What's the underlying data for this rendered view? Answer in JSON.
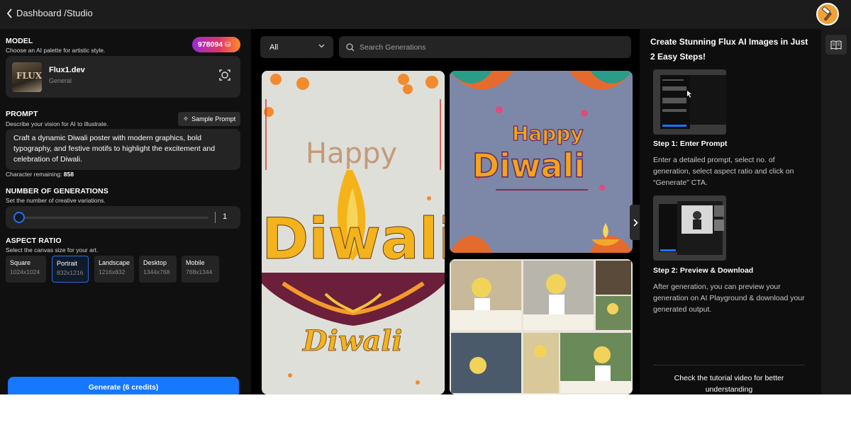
{
  "topbar": {
    "breadcrumb": "Dashboard /Studio"
  },
  "model": {
    "title": "MODEL",
    "subtitle": "Choose an AI palette for artistic style.",
    "credits": "978094",
    "name": "Flux1.dev",
    "type": "General",
    "thumb_text": "FLUX"
  },
  "prompt": {
    "title": "PROMPT",
    "subtitle": "Describe your vision for AI to illustrate.",
    "sample_label": "Sample Prompt",
    "text": "Craft a dynamic Diwali poster with modern graphics, bold typography, and festive motifs to highlight the excitement and celebration of Diwali.",
    "char_label": "Character remaining:",
    "char_count": "858"
  },
  "generations": {
    "title": "NUMBER OF GENERATIONS",
    "subtitle": "Set the number of creative variations.",
    "value": "1"
  },
  "aspect": {
    "title": "ASPECT RATIO",
    "subtitle": "Select the canvas size for your art.",
    "options": [
      {
        "name": "Square",
        "dims": "1024x1024"
      },
      {
        "name": "Portrait",
        "dims": "832x1216"
      },
      {
        "name": "Landscape",
        "dims": "1216x832"
      },
      {
        "name": "Desktop",
        "dims": "1344x768"
      },
      {
        "name": "Mobile",
        "dims": "768x1344"
      }
    ],
    "selected": "Portrait"
  },
  "generate_label": "Generate (6 credits)",
  "gallery": {
    "filter": "All",
    "search_placeholder": "Search Generations",
    "card1": {
      "line1": "Happy",
      "line2": "Diwali",
      "line3": "Diwali"
    },
    "card2": {
      "line1": "Happy",
      "line2": "Diwali"
    }
  },
  "guide": {
    "title": "Create Stunning Flux AI Images in Just 2 Easy Steps!",
    "step1_title": "Step 1: Enter Prompt",
    "step1_desc": "Enter a detailed prompt, select no. of generation, select aspect ratio and click on “Generate” CTA.",
    "step2_title": "Step 2: Preview & Download",
    "step2_desc": "After generation, you can preview your generation on AI Playground & download your generated output.",
    "footer": "Check the tutorial video for better understanding"
  },
  "colors": {
    "accent": "#1677ff",
    "panel": "#242424",
    "selected_border": "#2f6ee0"
  }
}
